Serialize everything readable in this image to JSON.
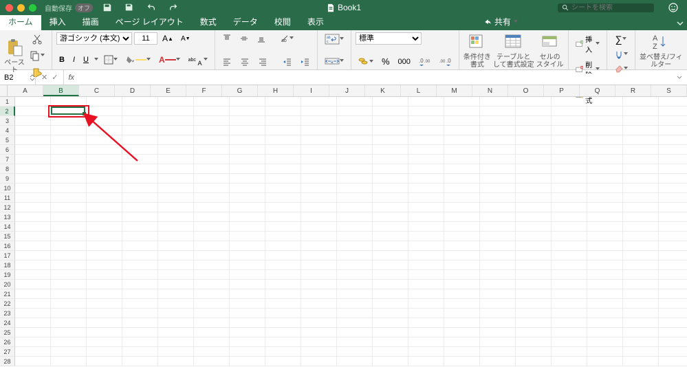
{
  "titlebar": {
    "autosave_label": "自動保存",
    "autosave_state": "オフ",
    "doc_title": "Book1",
    "search_placeholder": "シートを検索"
  },
  "tabs": {
    "items": [
      "ホーム",
      "挿入",
      "描画",
      "ページ レイアウト",
      "数式",
      "データ",
      "校閲",
      "表示"
    ],
    "active_index": 0,
    "share_label": "共有"
  },
  "ribbon": {
    "clipboard": {
      "paste_label": "ペースト"
    },
    "font": {
      "name": "游ゴシック (本文)",
      "size": "11",
      "bold": "B",
      "italic": "I",
      "underline": "U"
    },
    "number": {
      "format": "標準"
    },
    "styles": {
      "cond_fmt": "条件付き\n書式",
      "table_fmt": "テーブルと\nして書式設定",
      "cell_styles": "セルの\nスタイル"
    },
    "cells": {
      "insert": "挿入",
      "delete": "削除",
      "format": "書式"
    },
    "editing": {
      "sort_filter": "並べ替え/フィルター"
    }
  },
  "formula_bar": {
    "cell_ref": "B2",
    "fx": "fx",
    "value": ""
  },
  "grid": {
    "columns": [
      "A",
      "B",
      "C",
      "D",
      "E",
      "F",
      "G",
      "H",
      "I",
      "J",
      "K",
      "L",
      "M",
      "N",
      "O",
      "P",
      "Q",
      "R",
      "S"
    ],
    "rows": 28,
    "active": {
      "col_index": 1,
      "row_index": 1
    }
  },
  "colors": {
    "accent": "#217346",
    "annotation": "#e81123"
  }
}
